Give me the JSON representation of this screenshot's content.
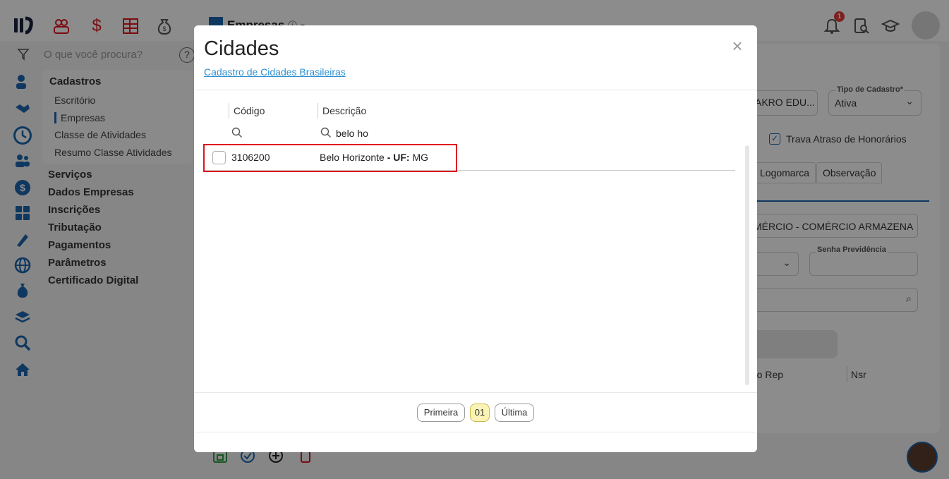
{
  "header": {
    "module_title": "Empresas",
    "notification_count": "1"
  },
  "search": {
    "placeholder": "O que você procura?",
    "help": "?"
  },
  "nav": {
    "section": "Cadastros",
    "sub_items": [
      "Escritório",
      "Empresas",
      "Classe de Atividades",
      "Resumo Classe Atividades"
    ],
    "active_sub": "Empresas",
    "items": [
      "Serviços",
      "Dados Empresas",
      "Inscrições",
      "Tributação",
      "Pagamentos",
      "Parâmetros",
      "Certificado Digital"
    ]
  },
  "background_form": {
    "field_partial": "AKRO EDU...",
    "tipo_cadastro_label": "Tipo de Cadastro*",
    "tipo_cadastro_value": "Ativa",
    "trava_label": "Trava Atraso de Honorários",
    "tabs": [
      "Logomarca",
      "Observação"
    ],
    "activity_value": "MÉRCIO - COMÉRCIO ARMAZENA",
    "senha_label": "Senha Previdência",
    "table_cols": [
      "ro Rep",
      "Nsr"
    ]
  },
  "modal": {
    "title": "Cidades",
    "subtitle": "Cadastro de Cidades Brasileiras",
    "close_label": "×",
    "columns": {
      "code": "Código",
      "description": "Descrição"
    },
    "filters": {
      "code": "",
      "description": "belo ho"
    },
    "rows": [
      {
        "code": "3106200",
        "city": "Belo Horizonte",
        "uf_label": "- UF:",
        "uf": "MG"
      }
    ],
    "pagination": {
      "first": "Primeira",
      "current": "01",
      "last": "Última"
    }
  },
  "colors": {
    "accent": "#1c66b0",
    "link": "#2d8fd0",
    "highlight": "#e0141e",
    "current_page": "#fbf3b5"
  }
}
